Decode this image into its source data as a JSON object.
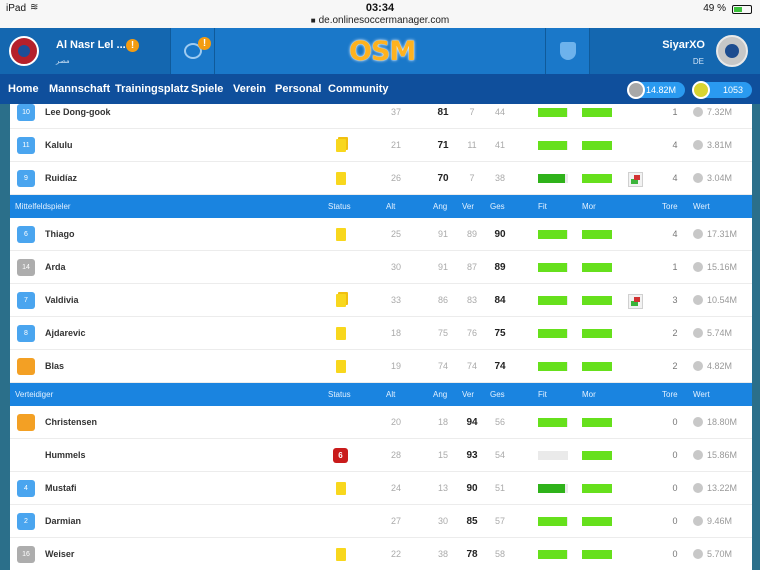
{
  "status_bar": {
    "device": "iPad",
    "time": "03:34",
    "url": "de.onlinesoccermanager.com",
    "battery": "49 %",
    "battery_level": 0.49
  },
  "header": {
    "club_name": "Al Nasr Lel ...",
    "club_country": "مصر",
    "alert_symbol": "!",
    "logo": "OSM",
    "user_name": "SiyarXO",
    "user_country": "DE"
  },
  "nav": {
    "items": [
      "Home",
      "Mannschaft",
      "Trainingsplatz",
      "Spiele",
      "Verein",
      "Personal",
      "Community"
    ],
    "money": "14.82M",
    "tokens": "1053"
  },
  "columns": {
    "status": "Status",
    "age": "Alt",
    "att": "Ang",
    "def": "Ver",
    "ovr": "Ges",
    "fit": "Fit",
    "morale": "Mor",
    "goals": "Tore",
    "value": "Wert"
  },
  "sections": [
    {
      "title": "",
      "players": [
        {
          "num": "10",
          "jersey": "blue",
          "name": "Lee Dong-gook",
          "status": "",
          "age": "37",
          "att": "81",
          "def": "7",
          "ovr": "44",
          "fit": 0.95,
          "mor": 1.0,
          "transfer": false,
          "goals": "1",
          "value": "7.32M"
        },
        {
          "num": "11",
          "jersey": "blue",
          "name": "Kalulu",
          "status": "card2",
          "age": "21",
          "att": "71",
          "def": "11",
          "ovr": "41",
          "fit": 0.95,
          "mor": 1.0,
          "transfer": false,
          "goals": "4",
          "value": "3.81M"
        },
        {
          "num": "9",
          "jersey": "blue",
          "name": "Ruidíaz",
          "status": "card",
          "age": "26",
          "att": "70",
          "def": "7",
          "ovr": "38",
          "fit": 0.9,
          "mor": 1.0,
          "transfer": true,
          "goals": "4",
          "value": "3.04M",
          "fit_dark": true
        }
      ]
    },
    {
      "title": "Mittelfeldspieler",
      "players": [
        {
          "num": "6",
          "jersey": "blue",
          "name": "Thiago",
          "status": "card",
          "age": "25",
          "att": "91",
          "def": "89",
          "ovr": "90",
          "fit": 0.95,
          "mor": 1.0,
          "transfer": false,
          "goals": "4",
          "value": "17.31M"
        },
        {
          "num": "14",
          "jersey": "gray",
          "name": "Arda",
          "status": "",
          "age": "30",
          "att": "91",
          "def": "87",
          "ovr": "89",
          "fit": 0.95,
          "mor": 1.0,
          "transfer": false,
          "goals": "1",
          "value": "15.16M"
        },
        {
          "num": "7",
          "jersey": "blue",
          "name": "Valdivia",
          "status": "card2",
          "age": "33",
          "att": "86",
          "def": "83",
          "ovr": "84",
          "fit": 0.95,
          "mor": 1.0,
          "transfer": true,
          "goals": "3",
          "value": "10.54M"
        },
        {
          "num": "8",
          "jersey": "blue",
          "name": "Ajdarevic",
          "status": "card",
          "age": "18",
          "att": "75",
          "def": "76",
          "ovr": "75",
          "fit": 0.95,
          "mor": 1.0,
          "transfer": false,
          "goals": "2",
          "value": "5.74M"
        },
        {
          "num": "",
          "jersey": "orange",
          "name": "Blas",
          "status": "card",
          "age": "19",
          "att": "74",
          "def": "74",
          "ovr": "74",
          "fit": 0.95,
          "mor": 1.0,
          "transfer": false,
          "goals": "2",
          "value": "4.82M"
        }
      ]
    },
    {
      "title": "Verteidiger",
      "players": [
        {
          "num": "",
          "jersey": "orange",
          "name": "Christensen",
          "status": "",
          "age": "20",
          "att": "18",
          "def": "94",
          "ovr": "56",
          "fit": 0.95,
          "mor": 1.0,
          "transfer": false,
          "goals": "0",
          "value": "18.80M"
        },
        {
          "num": "",
          "jersey": "none",
          "name": "Hummels",
          "status": "injury",
          "injury_days": "6",
          "age": "28",
          "att": "15",
          "def": "93",
          "ovr": "54",
          "fit": 0.0,
          "mor": 1.0,
          "transfer": false,
          "goals": "0",
          "value": "15.86M"
        },
        {
          "num": "4",
          "jersey": "blue",
          "name": "Mustafi",
          "status": "card",
          "age": "24",
          "att": "13",
          "def": "90",
          "ovr": "51",
          "fit": 0.9,
          "mor": 1.0,
          "transfer": false,
          "goals": "0",
          "value": "13.22M",
          "fit_dark": true
        },
        {
          "num": "2",
          "jersey": "blue",
          "name": "Darmian",
          "status": "",
          "age": "27",
          "att": "30",
          "def": "85",
          "ovr": "57",
          "fit": 0.95,
          "mor": 1.0,
          "transfer": false,
          "goals": "0",
          "value": "9.46M"
        },
        {
          "num": "16",
          "jersey": "gray",
          "name": "Weiser",
          "status": "card",
          "age": "22",
          "att": "38",
          "def": "78",
          "ovr": "58",
          "fit": 0.95,
          "mor": 1.0,
          "transfer": false,
          "goals": "0",
          "value": "5.70M"
        }
      ]
    }
  ]
}
